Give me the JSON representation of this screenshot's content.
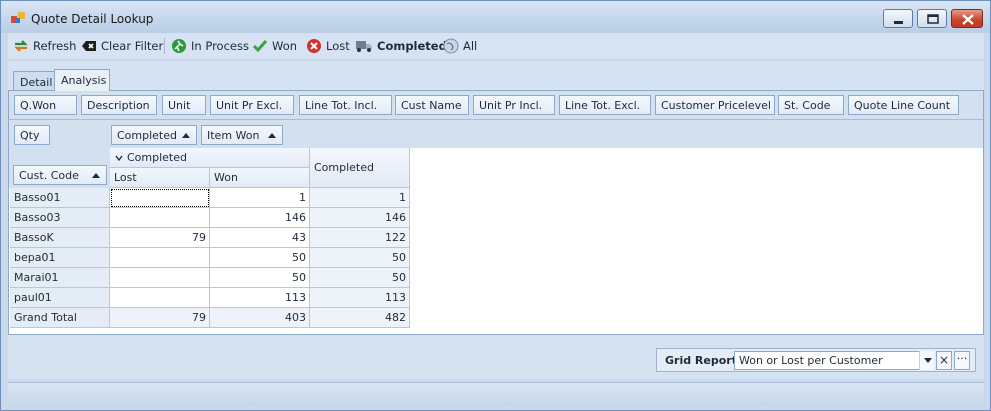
{
  "window": {
    "title": "Quote Detail Lookup"
  },
  "toolbar": {
    "refresh": "Refresh",
    "clear_filter": "Clear Filter",
    "in_process": "In Process",
    "won": "Won",
    "lost": "Lost",
    "completed": "Completed",
    "all": "All"
  },
  "tabs": {
    "detail": "Detail",
    "analysis": "Analysis"
  },
  "filter_fields": [
    "Q.Won",
    "Description",
    "Unit",
    "Unit Pr Excl.",
    "Line Tot. Incl.",
    "Cust Name",
    "Unit Pr Incl.",
    "Line Tot. Excl.",
    "Customer Pricelevel",
    "St. Code",
    "Quote Line Count"
  ],
  "data_field": "Qty",
  "column_fields": [
    "Completed",
    "Item Won"
  ],
  "row_field": "Cust. Code",
  "pivot": {
    "group_header": "Completed",
    "sub_headers": [
      "Lost",
      "Won"
    ],
    "total_header": "Completed",
    "rows": [
      {
        "code": "Basso01",
        "lost": "",
        "won": "1",
        "total": "1"
      },
      {
        "code": "Basso03",
        "lost": "",
        "won": "146",
        "total": "146"
      },
      {
        "code": "BassoK",
        "lost": "79",
        "won": "43",
        "total": "122"
      },
      {
        "code": "bepa01",
        "lost": "",
        "won": "50",
        "total": "50"
      },
      {
        "code": "Marai01",
        "lost": "",
        "won": "50",
        "total": "50"
      },
      {
        "code": "paul01",
        "lost": "",
        "won": "113",
        "total": "113"
      }
    ],
    "grand_total": {
      "label": "Grand Total",
      "lost": "79",
      "won": "403",
      "total": "482"
    }
  },
  "grid_report": {
    "label": "Grid Report:",
    "value": "Won or Lost per Customer"
  }
}
